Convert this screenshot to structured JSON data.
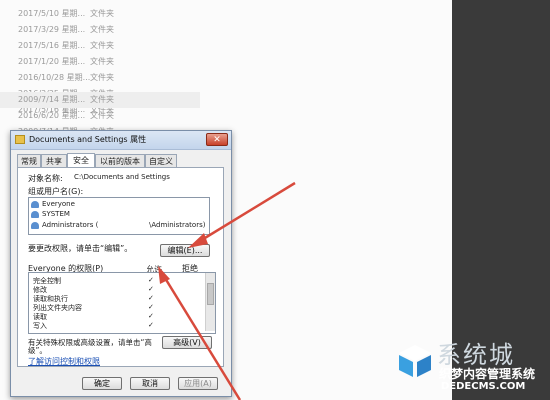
{
  "explorer": {
    "rows": [
      {
        "date": "2017/5/10 星期...",
        "type": "文件夹"
      },
      {
        "date": "2017/3/29 星期...",
        "type": "文件夹"
      },
      {
        "date": "2017/5/16 星期...",
        "type": "文件夹"
      },
      {
        "date": "2017/1/20 星期...",
        "type": "文件夹"
      },
      {
        "date": "2016/10/28 星期...",
        "type": "文件夹"
      },
      {
        "date": "2016/3/25 星期...",
        "type": "文件夹"
      },
      {
        "date": "2017/5/16 星期...",
        "type": "文件夹"
      },
      {
        "date": "2009/7/14 星期...",
        "type": "文件夹"
      },
      {
        "date": "2016/6/20 星期...",
        "type": "文件夹"
      },
      {
        "date": "2009/7/14 星期...",
        "type": "文件夹"
      }
    ]
  },
  "dialog": {
    "title": "Documents and Settings 属性",
    "close_label": "✕",
    "tabs": [
      "常规",
      "共享",
      "安全",
      "以前的版本",
      "自定义"
    ],
    "active_tab": "安全",
    "object_label": "对象名称:",
    "object_value": "C:\\Documents and Settings",
    "group_label": "组或用户名(G):",
    "users": [
      "Everyone",
      "SYSTEM",
      "Administrators (",
      "\\Administrators)"
    ],
    "change_perm_text": "要更改权限，请单击“编辑”。",
    "edit_button": "编辑(E)...",
    "perm_header": "Everyone 的权限(P)",
    "allow_header": "允许",
    "deny_header": "拒绝",
    "permissions": [
      {
        "name": "完全控制",
        "allow": "✓"
      },
      {
        "name": "修改",
        "allow": "✓"
      },
      {
        "name": "读取和执行",
        "allow": "✓"
      },
      {
        "name": "列出文件夹内容",
        "allow": "✓"
      },
      {
        "name": "读取",
        "allow": "✓"
      },
      {
        "name": "写入",
        "allow": "✓"
      }
    ],
    "special_text_1": "有关特殊权限或高级设置，请单击“高",
    "special_text_2": "级”。",
    "advanced_button": "高级(V)",
    "link_text": "了解访问控制和权限",
    "ok_button": "确定",
    "cancel_button": "取消",
    "apply_button": "应用(A)"
  },
  "watermark": {
    "big_text": "系统城",
    "cn_text": "织梦内容管理系统",
    "url_text": "DEDECMS.COM"
  },
  "colors": {
    "arrow": "#d84a3c",
    "dark_panel": "#3a3a3a",
    "link": "#1a4fb4"
  }
}
